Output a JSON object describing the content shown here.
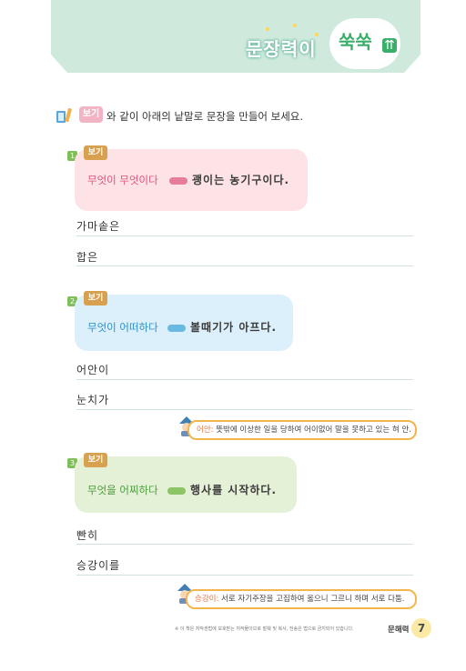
{
  "header": {
    "title": "문장력이",
    "accent": "쑥쑥",
    "accent_arrow": "⇈",
    "colors": {
      "banner": "#cfeadd",
      "accent": "#3cae6c"
    }
  },
  "instruction": {
    "example_tag": "보기",
    "text": "와 같이 아래의 낱말로 문장을 만들어 보세요."
  },
  "examples": [
    {
      "number": "1",
      "tag": "보기",
      "pattern": "무엇이 무엇이다",
      "sentence": "괭이는 농기구이다.",
      "practice_words": [
        "가마솥은",
        "합은"
      ],
      "colors": {
        "card": "#fde3e6",
        "tag": "#d8a14f",
        "pattern_text": "#e0527a",
        "arrow": "#e57c9a"
      }
    },
    {
      "number": "2",
      "tag": "보기",
      "pattern": "무엇이 어떠하다",
      "sentence": "볼때기가 아프다.",
      "practice_words": [
        "어안이",
        "눈치가"
      ],
      "note_term": "어안:",
      "note_text": "뜻밖에 이상한 일을 당하여 어이없어 말을 못하고 있는 혀 안.",
      "colors": {
        "card": "#dcf0fb",
        "tag": "#d8a14f",
        "pattern_text": "#2d8ec4",
        "arrow": "#6ab9e0"
      }
    },
    {
      "number": "3",
      "tag": "보기",
      "pattern": "무엇을 어찌하다",
      "sentence": "행사를 시작하다.",
      "practice_words": [
        "빤히",
        "승강이를"
      ],
      "note_term": "승강이:",
      "note_text": "서로 자기주장을 고집하여 옳으니 그르니 하며 서로 다툼.",
      "colors": {
        "card": "#e4f1d6",
        "tag": "#d8a14f",
        "pattern_text": "#4c9a3a",
        "arrow": "#8cc466"
      }
    }
  ],
  "footer": {
    "note": "※ 이 책은 저작권법에 보호받는 저작물이므로 발췌 및 복사, 전송은 법으로 금지되어 있습니다.",
    "label": "문해력",
    "page_number": "7"
  }
}
